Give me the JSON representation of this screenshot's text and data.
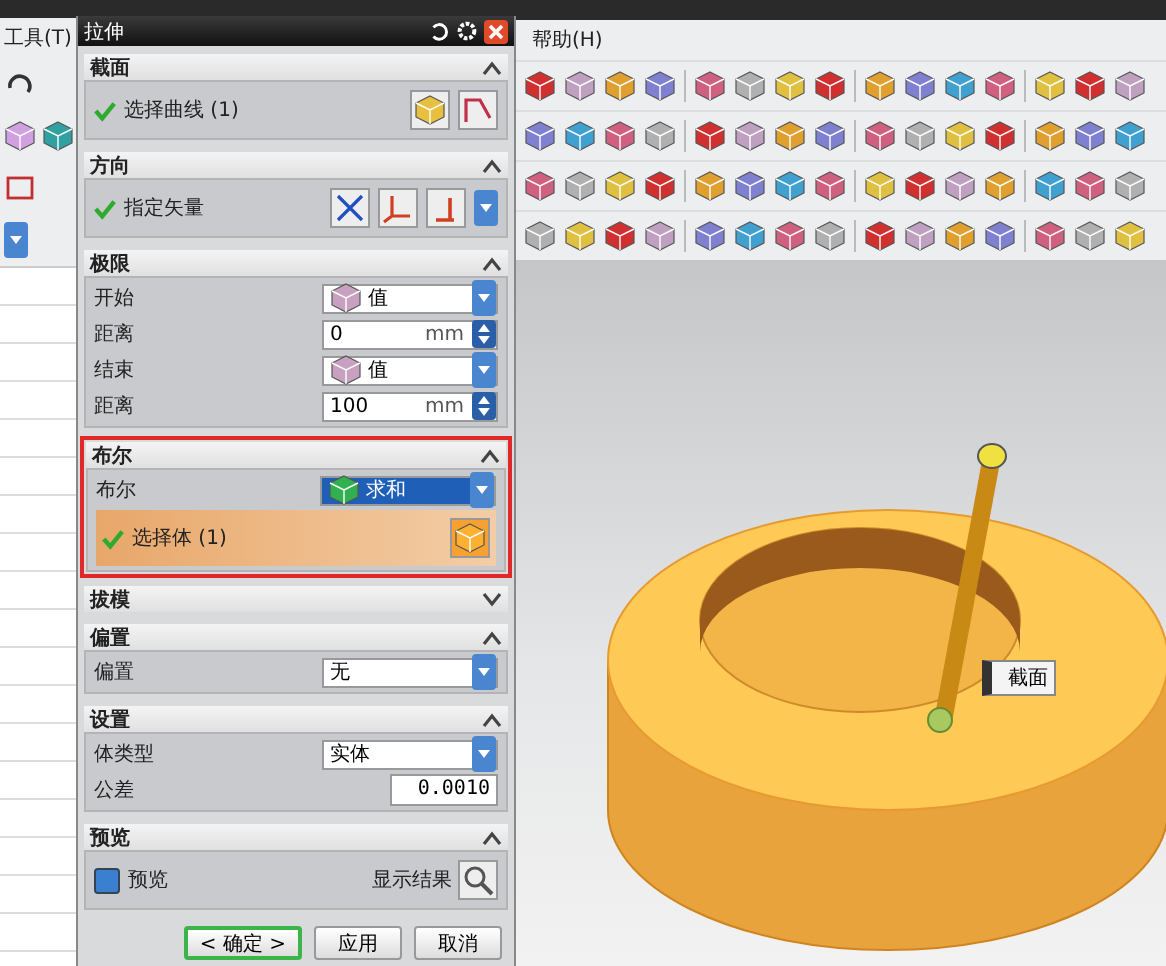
{
  "left_menu": "工具(T)",
  "right_menu": "帮助(H)",
  "dialog": {
    "title": "拉伸",
    "sections": [
      {
        "title": "截面",
        "expanded": true,
        "highlighted": false,
        "rows": [
          {
            "kind": "curve",
            "label": "选择曲线 (1)",
            "complete": true,
            "active": false
          }
        ]
      },
      {
        "title": "方向",
        "expanded": true,
        "highlighted": false,
        "rows": [
          {
            "kind": "vector",
            "label": "指定矢量",
            "complete": true,
            "active": false
          }
        ]
      },
      {
        "title": "极限",
        "expanded": true,
        "highlighted": false,
        "rows": [
          {
            "kind": "dropdown",
            "label": "开始",
            "value": "值",
            "icon": true,
            "active": false
          },
          {
            "kind": "number",
            "label": "距离",
            "value": "0",
            "unit": "mm"
          },
          {
            "kind": "dropdown",
            "label": "结束",
            "value": "值",
            "icon": true,
            "active": false
          },
          {
            "kind": "number",
            "label": "距离",
            "value": "100",
            "unit": "mm"
          }
        ]
      },
      {
        "title": "布尔",
        "expanded": true,
        "highlighted": true,
        "rows": [
          {
            "kind": "dropdown",
            "label": "布尔",
            "value": "求和",
            "icon": true,
            "active": true
          },
          {
            "kind": "body",
            "label": "选择体 (1)",
            "complete": true,
            "active": true
          }
        ]
      },
      {
        "title": "拔模",
        "expanded": false,
        "highlighted": false
      },
      {
        "title": "偏置",
        "expanded": true,
        "highlighted": false,
        "rows": [
          {
            "kind": "dropdown",
            "label": "偏置",
            "value": "无",
            "icon": false,
            "active": false
          }
        ]
      },
      {
        "title": "设置",
        "expanded": true,
        "highlighted": false,
        "rows": [
          {
            "kind": "dropdown",
            "label": "体类型",
            "value": "实体",
            "icon": false,
            "active": false
          },
          {
            "kind": "field",
            "label": "公差",
            "value": "0.0010"
          }
        ]
      },
      {
        "title": "预览",
        "expanded": true,
        "highlighted": false,
        "rows": [
          {
            "kind": "checkbox",
            "label": "预览",
            "checked": true,
            "button_label": "显示结果"
          }
        ]
      }
    ],
    "buttons": [
      {
        "label": "< 确定 >",
        "default": true
      },
      {
        "label": "应用",
        "default": false
      },
      {
        "label": "取消",
        "default": false
      }
    ]
  },
  "viewport": {
    "tag": "截面"
  }
}
